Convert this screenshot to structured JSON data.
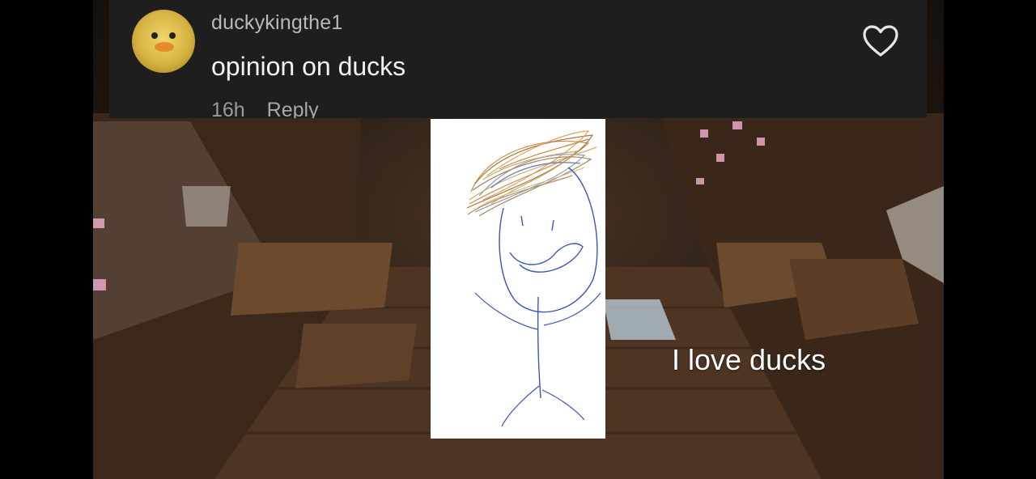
{
  "comment": {
    "username": "duckykingthe1",
    "text": "opinion on ducks",
    "time": "16h",
    "reply_label": "Reply",
    "like_icon": "heart-outline-icon"
  },
  "caption": "I love ducks",
  "colors": {
    "card_background": "#1e1e1e",
    "scene_wood": "#5a3d27"
  }
}
